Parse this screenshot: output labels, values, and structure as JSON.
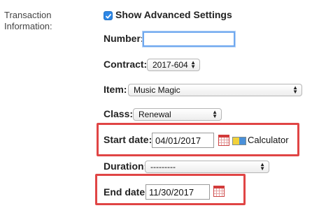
{
  "section": {
    "label_line1": "Transaction",
    "label_line2": "Information:"
  },
  "advanced": {
    "label": "Show Advanced Settings",
    "checked": true
  },
  "number": {
    "label": "Number:",
    "value": ""
  },
  "contract": {
    "label": "Contract:",
    "value": "2017-604"
  },
  "item": {
    "label": "Item:",
    "value": "Music Magic"
  },
  "class": {
    "label": "Class:",
    "value": "Renewal"
  },
  "start_date": {
    "label": "Start date:",
    "value": "04/01/2017",
    "calculator_label": "Calculator"
  },
  "duration": {
    "label": "Duration:",
    "value": "---------"
  },
  "end_date": {
    "label": "End date:",
    "value": "11/30/2017"
  },
  "colors": {
    "highlight": "#e04545",
    "checkbox": "#2d87e6",
    "focus": "#6fa8ef"
  }
}
